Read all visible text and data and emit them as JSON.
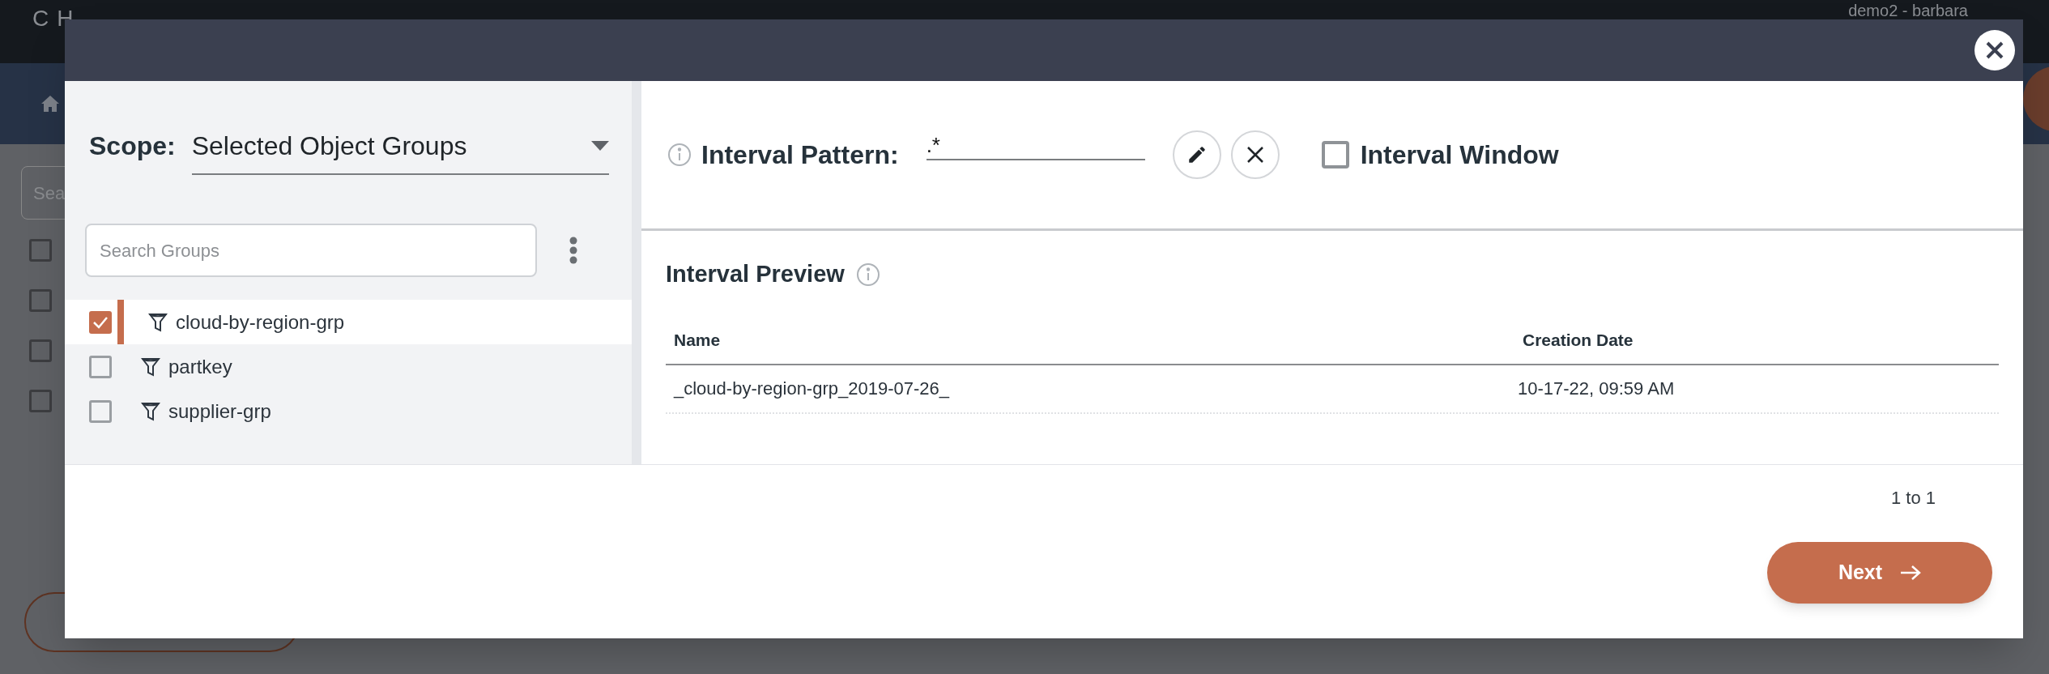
{
  "background": {
    "logo": "CH",
    "search_placeholder": "Sea",
    "user": "demo2 - barbara",
    "rows": [
      {
        "checked": false
      },
      {
        "checked": false
      },
      {
        "checked": false
      },
      {
        "checked": false
      }
    ]
  },
  "dialog": {
    "scope": {
      "label": "Scope:",
      "value": "Selected Object Groups"
    },
    "group_search": {
      "placeholder": "Search Groups"
    },
    "groups": [
      {
        "name": "cloud-by-region-grp",
        "checked": true,
        "selected": true
      },
      {
        "name": "partkey",
        "checked": false,
        "selected": false
      },
      {
        "name": "supplier-grp",
        "checked": false,
        "selected": false
      }
    ],
    "interval_pattern": {
      "label": "Interval Pattern:",
      "value": ".*"
    },
    "interval_window": {
      "label": "Interval Window",
      "checked": false
    },
    "preview": {
      "title": "Interval Preview",
      "columns": [
        "Name",
        "Creation Date"
      ],
      "rows": [
        [
          "_cloud-by-region-grp_2019-07-26_",
          "10-17-22, 09:59 AM"
        ]
      ]
    },
    "pagination": "1 to 1",
    "next_button": "Next"
  }
}
